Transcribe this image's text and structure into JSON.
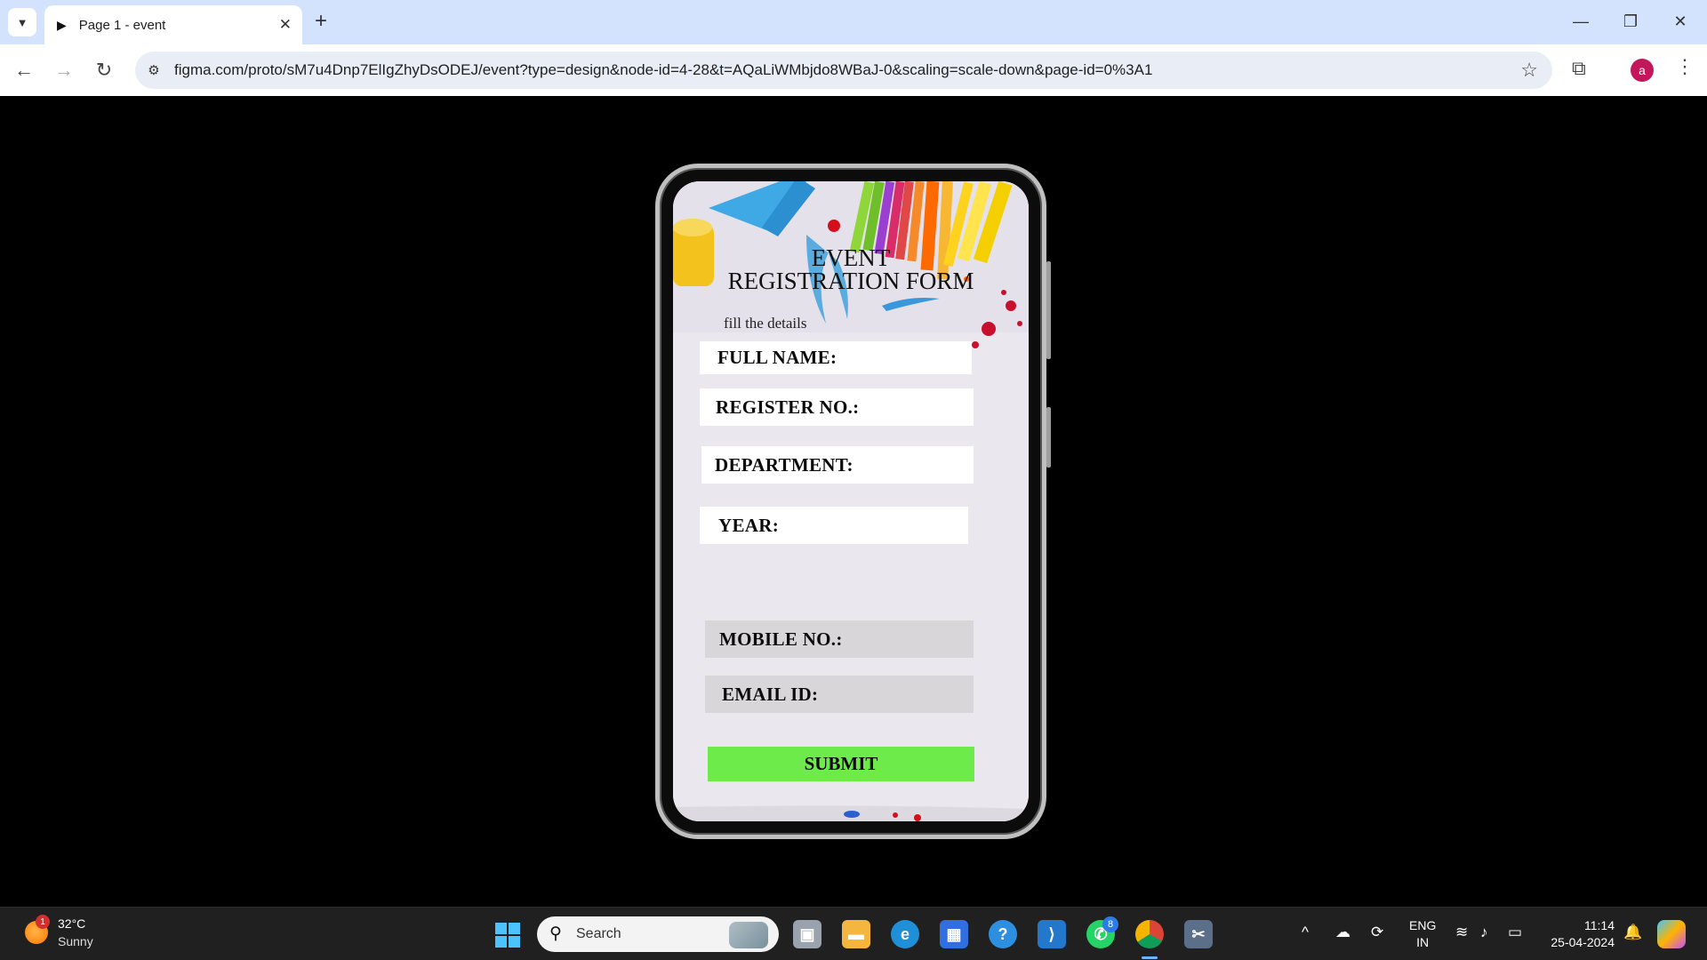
{
  "browser": {
    "tab_title": "Page 1 - event",
    "url": "figma.com/proto/sM7u4Dnp7ElIgZhyDsODEJ/event?type=design&node-id=4-28&t=AQaLiWMbjdo8WBaJ-0&scaling=scale-down&page-id=0%3A1",
    "profile_initial": "a"
  },
  "form": {
    "title_line1": "EVENT",
    "title_line2": "REGISTRATION FORM",
    "subtitle": "fill the details",
    "fields": {
      "full_name": "FULL NAME:",
      "register_no": "REGISTER NO.:",
      "department": "DEPARTMENT:",
      "year": "YEAR:",
      "mobile_no": "MOBILE NO.:",
      "email_id": "EMAIL ID:"
    },
    "submit_label": "SUBMIT",
    "colors": {
      "submit": "#6ceb4b",
      "field_white": "#ffffff",
      "field_grey": "#d8d6d9"
    }
  },
  "taskbar": {
    "weather_temp": "32°C",
    "weather_desc": "Sunny",
    "weather_badge": "1",
    "search_label": "Search",
    "whatsapp_badge": "8",
    "lang_line1": "ENG",
    "lang_line2": "IN",
    "time": "11:14",
    "date": "25-04-2024"
  }
}
